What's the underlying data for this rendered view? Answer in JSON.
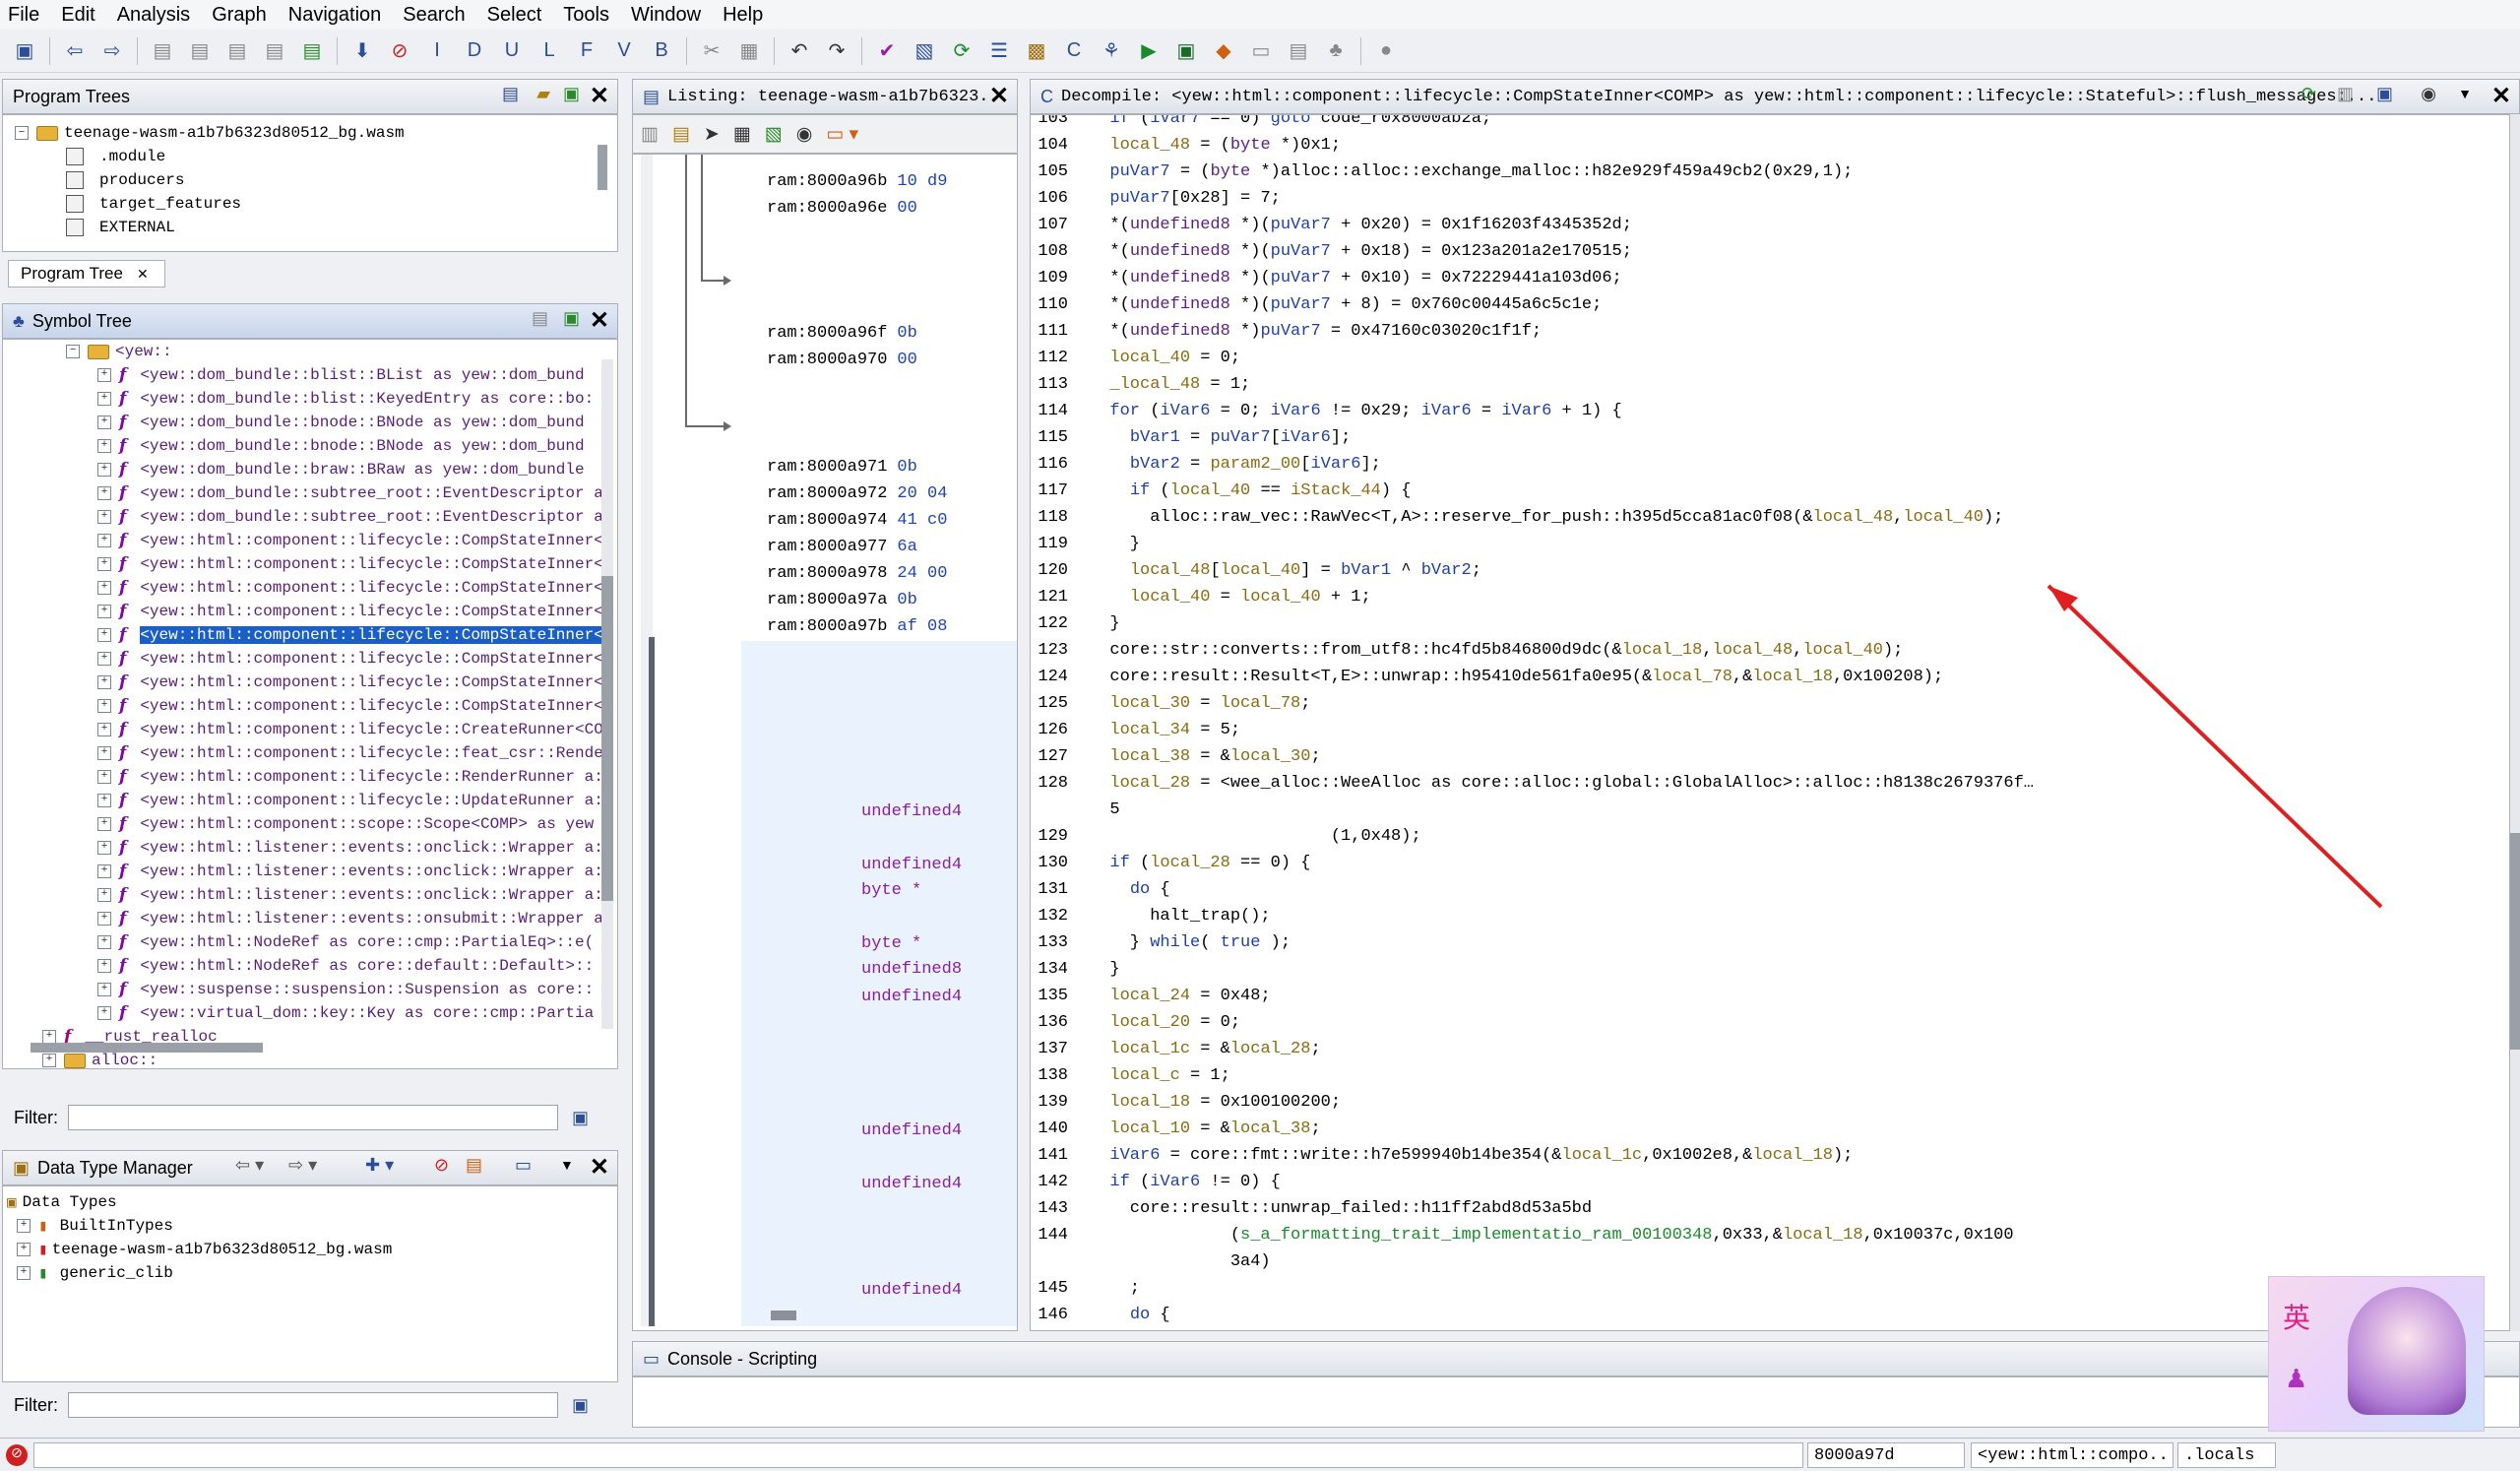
{
  "menu": [
    "File",
    "Edit",
    "Analysis",
    "Graph",
    "Navigation",
    "Search",
    "Select",
    "Tools",
    "Window",
    "Help"
  ],
  "program_trees": {
    "title": "Program Trees",
    "root": "teenage-wasm-a1b7b6323d80512_bg.wasm",
    "children": [
      ".module",
      "producers",
      "target_features",
      "EXTERNAL"
    ],
    "tab": "Program Tree"
  },
  "symbol_tree": {
    "title": "Symbol Tree",
    "folder": "<yew::",
    "items": [
      "<yew::dom_bundle::blist::BList  as  yew::dom_bund",
      "<yew::dom_bundle::blist::KeyedEntry  as  core::bo:",
      "<yew::dom_bundle::bnode::BNode  as  yew::dom_bund",
      "<yew::dom_bundle::bnode::BNode  as  yew::dom_bund",
      "<yew::dom_bundle::braw::BRaw  as  yew::dom_bundle",
      "<yew::dom_bundle::subtree_root::EventDescriptor  a",
      "<yew::dom_bundle::subtree_root::EventDescriptor  a",
      "<yew::html::component::lifecycle::CompStateInner<",
      "<yew::html::component::lifecycle::CompStateInner<",
      "<yew::html::component::lifecycle::CompStateInner<",
      "<yew::html::component::lifecycle::CompStateInner<",
      "<yew::html::component::lifecycle::CompStateInner<",
      "<yew::html::component::lifecycle::CompStateInner<",
      "<yew::html::component::lifecycle::CompStateInner<",
      "<yew::html::component::lifecycle::CompStateInner<",
      "<yew::html::component::lifecycle::CreateRunner<COM",
      "<yew::html::component::lifecycle::feat_csr::Render",
      "<yew::html::component::lifecycle::RenderRunner  a:",
      "<yew::html::component::lifecycle::UpdateRunner  a:",
      "<yew::html::component::scope::Scope<COMP>  as  yew",
      "<yew::html::listener::events::onclick::Wrapper  a:",
      "<yew::html::listener::events::onclick::Wrapper  a:",
      "<yew::html::listener::events::onclick::Wrapper  a:",
      "<yew::html::listener::events::onsubmit::Wrapper  a",
      "<yew::html::NodeRef  as  core::cmp::PartialEq>::e(",
      "<yew::html::NodeRef  as  core::default::Default>::",
      "<yew::suspense::suspension::Suspension  as  core::",
      "<yew::virtual_dom::key::Key  as  core::cmp::Partia"
    ],
    "selected_index": 11,
    "extra": [
      "__rust_realloc",
      "alloc::"
    ],
    "filter_label": "Filter:"
  },
  "data_type_manager": {
    "title": "Data Type Manager",
    "root": "Data Types",
    "items": [
      "BuiltInTypes",
      "teenage-wasm-a1b7b6323d80512_bg.wasm",
      "generic_clib"
    ],
    "filter_label": "Filter:"
  },
  "listing": {
    "title": "Listing:  teenage-wasm-a1b7b6323...",
    "rows": [
      {
        "addr": "ram:8000a96b",
        "hex": "10 d9"
      },
      {
        "addr": "ram:8000a96e",
        "hex": "00"
      },
      {
        "addr": "ram:8000a96f",
        "hex": "0b"
      },
      {
        "addr": "ram:8000a970",
        "hex": "00"
      },
      {
        "addr": "ram:8000a971",
        "hex": "0b"
      },
      {
        "addr": "ram:8000a972",
        "hex": "20 04"
      },
      {
        "addr": "ram:8000a974",
        "hex": "41 c0"
      },
      {
        "addr": "ram:8000a977",
        "hex": "6a"
      },
      {
        "addr": "ram:8000a978",
        "hex": "24 00"
      },
      {
        "addr": "ram:8000a97a",
        "hex": "0b"
      },
      {
        "addr": "ram:8000a97b",
        "hex": "af 08"
      }
    ],
    "types": [
      "undefined4",
      "undefined4",
      "byte *",
      "byte *",
      "undefined8",
      "undefined4",
      "undefined4",
      "undefined4",
      "undefined4"
    ]
  },
  "decompile": {
    "title": "Decompile: <yew::html::component::lifecycle::CompStateInner<COMP>  as  yew::html::component::lifecycle::Stateful>::flush_messages:...",
    "lines": [
      {
        "n": "103",
        "t": "  if (iVar7 == 0) goto code_r0x8000ab2a;"
      },
      {
        "n": "104",
        "t": "  local_48 = (byte *)0x1;"
      },
      {
        "n": "105",
        "t": "  puVar7 = (byte *)alloc::alloc::exchange_malloc::h82e929f459a49cb2(0x29,1);"
      },
      {
        "n": "106",
        "t": "  puVar7[0x28] = 7;"
      },
      {
        "n": "107",
        "t": "  *(undefined8 *)(puVar7 + 0x20) = 0x1f16203f4345352d;"
      },
      {
        "n": "108",
        "t": "  *(undefined8 *)(puVar7 + 0x18) = 0x123a201a2e170515;"
      },
      {
        "n": "109",
        "t": "  *(undefined8 *)(puVar7 + 0x10) = 0x72229441a103d06;"
      },
      {
        "n": "110",
        "t": "  *(undefined8 *)(puVar7 + 8) = 0x760c00445a6c5c1e;"
      },
      {
        "n": "111",
        "t": "  *(undefined8 *)puVar7 = 0x47160c03020c1f1f;"
      },
      {
        "n": "112",
        "t": "  local_40 = 0;"
      },
      {
        "n": "113",
        "t": "  _local_48 = 1;"
      },
      {
        "n": "114",
        "t": "  for (iVar6 = 0; iVar6 != 0x29; iVar6 = iVar6 + 1) {"
      },
      {
        "n": "115",
        "t": "    bVar1 = puVar7[iVar6];"
      },
      {
        "n": "116",
        "t": "    bVar2 = param2_00[iVar6];"
      },
      {
        "n": "117",
        "t": "    if (local_40 == iStack_44) {"
      },
      {
        "n": "118",
        "t": "      alloc::raw_vec::RawVec<T,A>::reserve_for_push::h395d5cca81ac0f08(&local_48,local_40);"
      },
      {
        "n": "119",
        "t": "    }"
      },
      {
        "n": "120",
        "t": "    local_48[local_40] = bVar1 ^ bVar2;"
      },
      {
        "n": "121",
        "t": "    local_40 = local_40 + 1;"
      },
      {
        "n": "122",
        "t": "  }"
      },
      {
        "n": "123",
        "t": "  core::str::converts::from_utf8::hc4fd5b846800d9dc(&local_18,local_48,local_40);"
      },
      {
        "n": "124",
        "t": "  core::result::Result<T,E>::unwrap::h95410de561fa0e95(&local_78,&local_18,0x100208);"
      },
      {
        "n": "125",
        "t": "  local_30 = local_78;"
      },
      {
        "n": "126",
        "t": "  local_34 = 5;"
      },
      {
        "n": "127",
        "t": "  local_38 = &local_30;"
      },
      {
        "n": "128",
        "t": "  local_28 = <wee_alloc::WeeAlloc as core::alloc::global::GlobalAlloc>::alloc::h8138c2679376f…"
      },
      {
        "n": "",
        "t": "  5"
      },
      {
        "n": "129",
        "t": "                        (1,0x48);"
      },
      {
        "n": "130",
        "t": "  if (local_28 == 0) {"
      },
      {
        "n": "131",
        "t": "    do {"
      },
      {
        "n": "132",
        "t": "      halt_trap();"
      },
      {
        "n": "133",
        "t": "    } while( true );"
      },
      {
        "n": "134",
        "t": "  }"
      },
      {
        "n": "135",
        "t": "  local_24 = 0x48;"
      },
      {
        "n": "136",
        "t": "  local_20 = 0;"
      },
      {
        "n": "137",
        "t": "  local_1c = &local_28;"
      },
      {
        "n": "138",
        "t": "  local_c = 1;"
      },
      {
        "n": "139",
        "t": "  local_18 = 0x100100200;"
      },
      {
        "n": "140",
        "t": "  local_10 = &local_38;"
      },
      {
        "n": "141",
        "t": "  iVar6 = core::fmt::write::h7e599940b14be354(&local_1c,0x1002e8,&local_18);"
      },
      {
        "n": "142",
        "t": "  if (iVar6 != 0) {"
      },
      {
        "n": "143",
        "t": "    core::result::unwrap_failed::h11ff2abd8d53a5bd"
      },
      {
        "n": "144",
        "t": "              (s_a_formatting_trait_implementatio_ram_00100348,0x33,&local_18,0x10037c,0x100"
      },
      {
        "n": "",
        "t": "              3a4)"
      },
      {
        "n": "145",
        "t": "    ;"
      },
      {
        "n": "146",
        "t": "    do {"
      }
    ]
  },
  "console": {
    "title": "Console - Scripting"
  },
  "status": {
    "address": "8000a97d",
    "function": "<yew::html::compo...",
    "location": ".locals"
  },
  "colors": {
    "selection": "#1b5fc6",
    "arrow": "#e02020"
  }
}
